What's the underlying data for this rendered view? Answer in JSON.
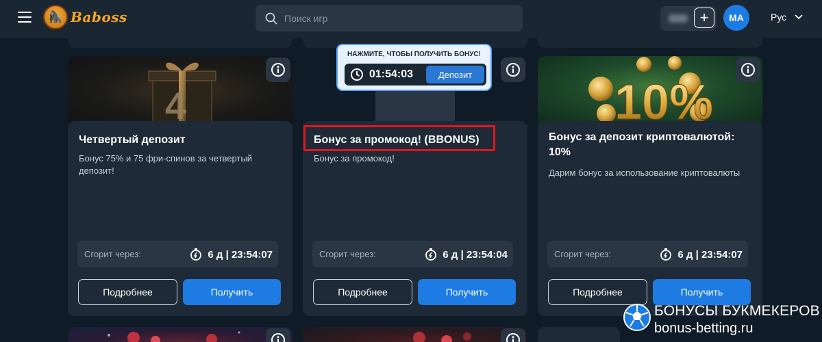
{
  "header": {
    "logo_text": "Baboss",
    "search_placeholder": "Поиск игр",
    "avatar_initials": "MA",
    "language": "Рус"
  },
  "timer_popup": {
    "heading": "НАЖМИТЕ, ЧТОБЫ ПОЛУЧИТЬ БОНУС!",
    "time": "01:54:03",
    "button_label": "Депозит"
  },
  "cards": [
    {
      "title": "Четвертый депозит",
      "description": "Бонус 75% и 75 фри-спинов за четвертый депозит!",
      "expire_label": "Сгорит через:",
      "expire_time": "6 д | 23:54:07",
      "more_label": "Подробнее",
      "get_label": "Получить"
    },
    {
      "title": "Бонус за промокод! (BBONUS)",
      "description": "Бонус за промокод!",
      "expire_label": "Сгорит через:",
      "expire_time": "6 д | 23:54:04",
      "more_label": "Подробнее",
      "get_label": "Получить"
    },
    {
      "title": "Бонус за депозит криптовалютой: 10%",
      "description": "Дарим бонус за использование криптовалюты",
      "expire_label": "Сгорит через:",
      "expire_time": "6 д | 23:54:07",
      "more_label": "Подробнее",
      "get_label": "Получить"
    }
  ],
  "card_images": {
    "card1": "4",
    "card3": "10%"
  },
  "watermark": {
    "line1": "БОНУСЫ БУКМЕКЕРОВ",
    "line2": "bonus-betting.ru"
  },
  "colors": {
    "background": "#0f1b27",
    "header": "#1b2633",
    "card": "#1e2a37",
    "accent_blue": "#1e7be3",
    "highlight_red": "#e0161c"
  }
}
